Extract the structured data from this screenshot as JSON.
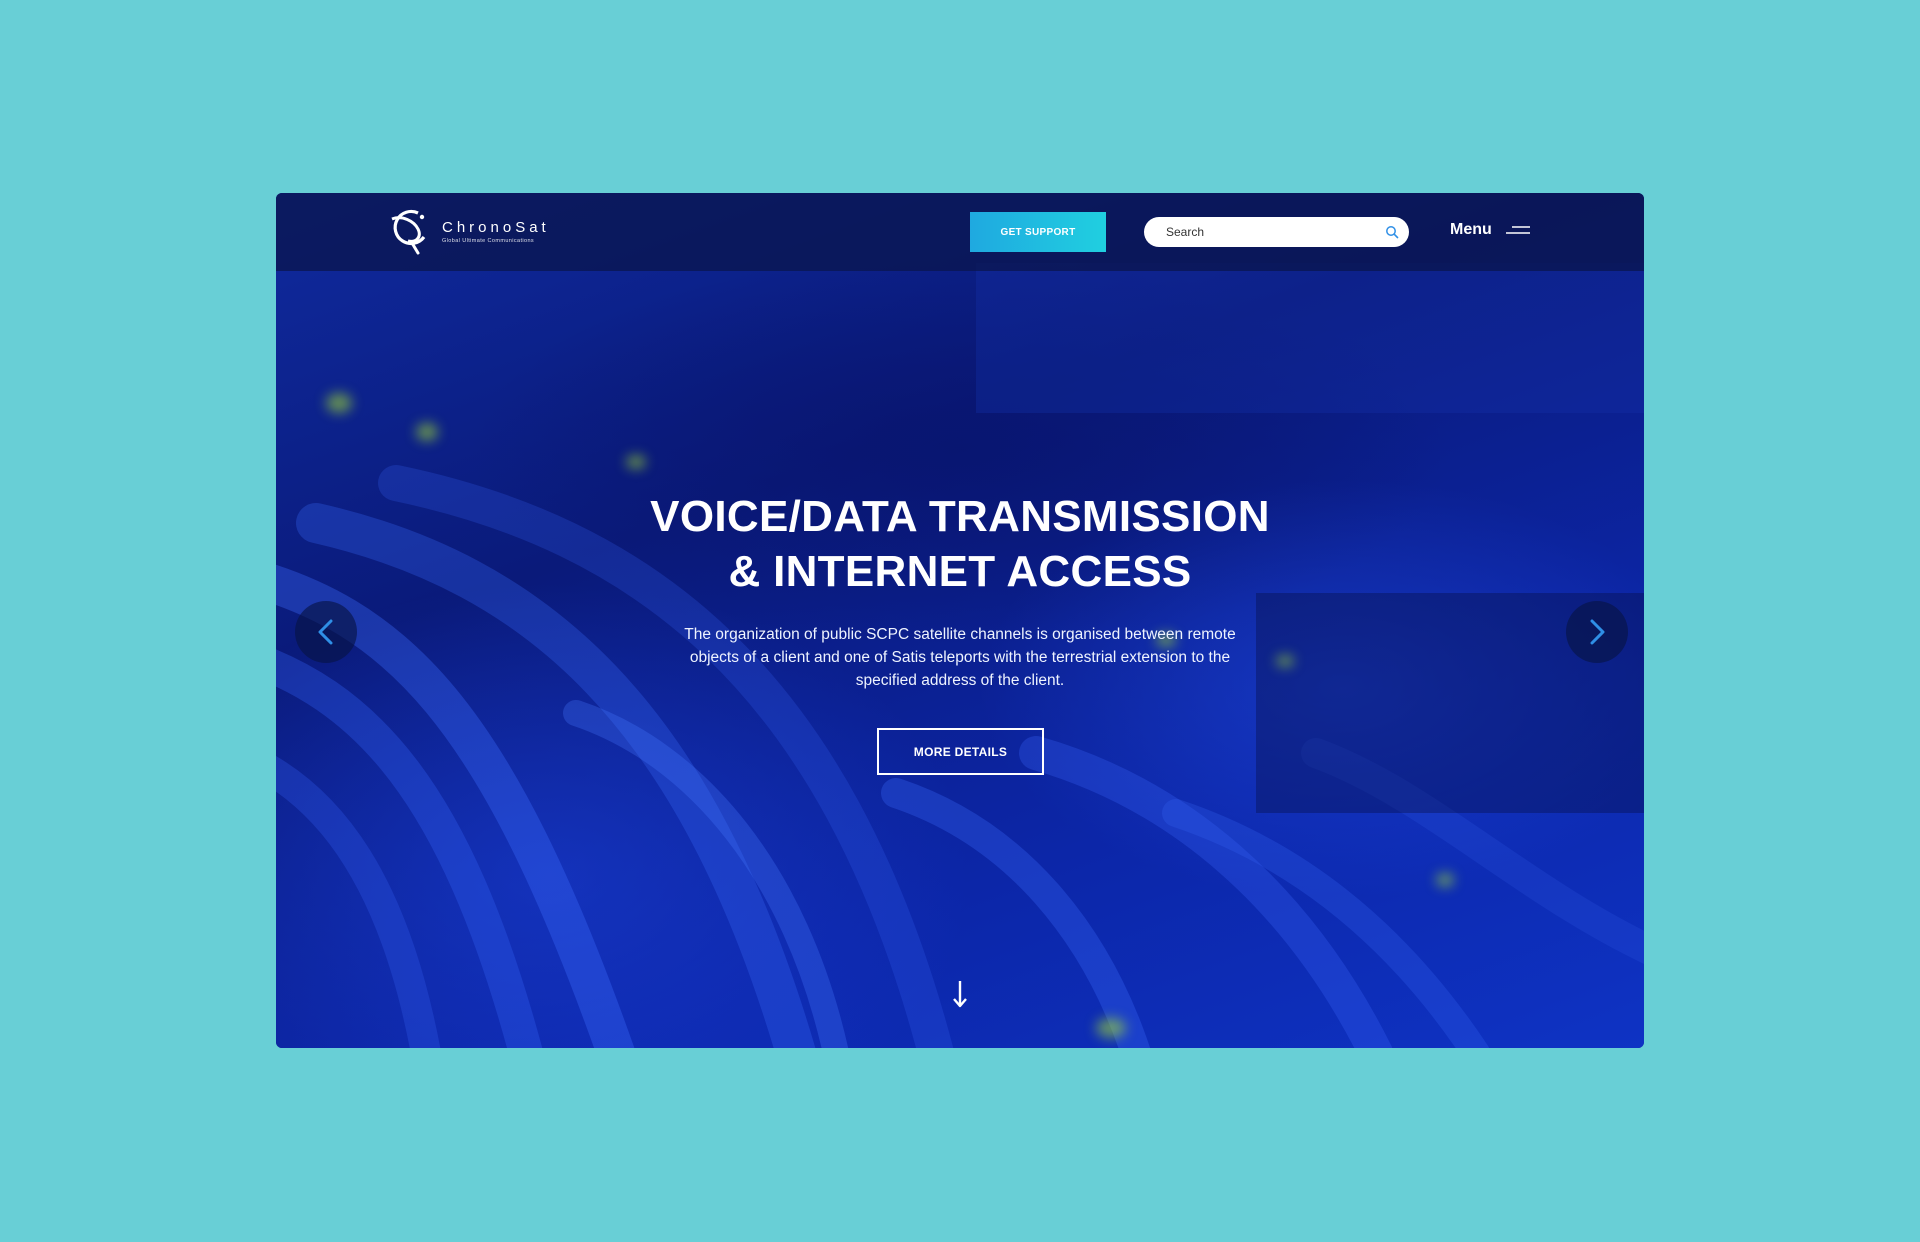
{
  "brand": {
    "name": "ChronoSat",
    "tagline": "Global Ultimate Communications"
  },
  "header": {
    "support_label": "GET SUPPORT",
    "search_placeholder": "Search",
    "menu_label": "Menu"
  },
  "hero": {
    "title_line1": "VOICE/DATA TRANSMISSION",
    "title_line2": "& INTERNET ACCESS",
    "description": "The organization of public SCPC satellite channels is organised between remote objects of a client and one of Satis teleports with the terrestrial extension to the specified address of the client.",
    "cta_label": "MORE DETAILS"
  },
  "icons": {
    "logo": "chronosat-logo-icon",
    "search": "search-icon",
    "menu": "hamburger-icon",
    "prev": "chevron-left-icon",
    "next": "chevron-right-icon",
    "scroll": "arrow-down-icon"
  },
  "colors": {
    "page_background": "#68cfd6",
    "hero_blue": "#0b1e7e",
    "accent_cyan": "#20cfe0",
    "arrow_blue": "#2f8fe6"
  }
}
